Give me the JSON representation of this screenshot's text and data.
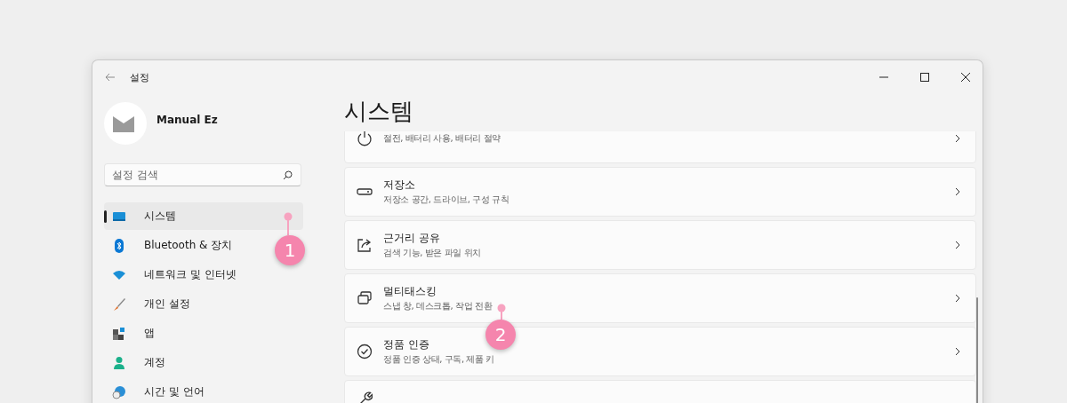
{
  "window": {
    "title": "설정"
  },
  "profile": {
    "name": "Manual Ez"
  },
  "search": {
    "placeholder": "설정 검색"
  },
  "nav": [
    {
      "kind": "system",
      "label": "시스템",
      "selected": true
    },
    {
      "kind": "bluetooth",
      "label": "Bluetooth & 장치",
      "selected": false
    },
    {
      "kind": "network",
      "label": "네트워크 및 인터넷",
      "selected": false
    },
    {
      "kind": "personalize",
      "label": "개인 설정",
      "selected": false
    },
    {
      "kind": "apps",
      "label": "앱",
      "selected": false
    },
    {
      "kind": "account",
      "label": "계정",
      "selected": false
    },
    {
      "kind": "time",
      "label": "시간 및 언어",
      "selected": false
    }
  ],
  "page": {
    "title": "시스템"
  },
  "cards": [
    {
      "kind": "power",
      "subtitle": "절전, 배터리 사용, 배터리 절약"
    },
    {
      "kind": "storage",
      "title": "저장소",
      "subtitle": "저장소 공간, 드라이브, 구성 규칙"
    },
    {
      "kind": "share",
      "title": "근거리 공유",
      "subtitle": "검색 기능, 받은 파일 위치"
    },
    {
      "kind": "multitask",
      "title": "멀티태스킹",
      "subtitle": "스냅 창, 데스크톱, 작업 전환"
    },
    {
      "kind": "activation",
      "title": "정품 인증",
      "subtitle": "정품 인증 상태, 구독, 제품 키"
    },
    {
      "kind": "troubleshoot"
    }
  ],
  "callouts": [
    {
      "label": "1"
    },
    {
      "label": "2"
    }
  ]
}
